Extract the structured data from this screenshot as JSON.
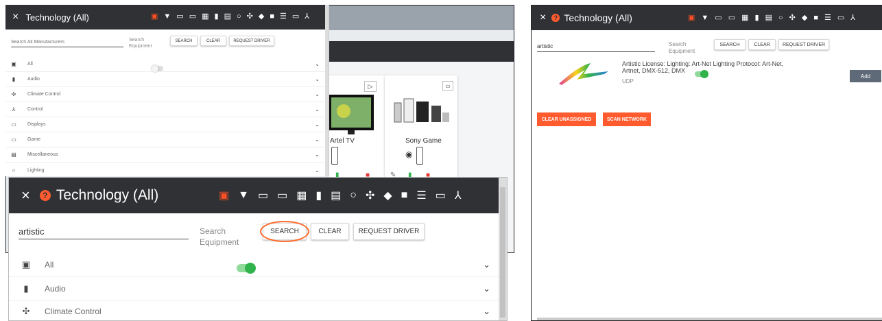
{
  "colors": {
    "header_bg": "#2f3135",
    "accent": "#ff5b2e",
    "toggle_green": "#2fb34a",
    "toggle_green_track": "#8fd99b"
  },
  "header": {
    "close_glyph": "×",
    "title": "Technology (All)",
    "help_glyph": "?"
  },
  "tech_icons": [
    "all-icon",
    "plug-icon",
    "display-icon",
    "projector-icon",
    "film-icon",
    "audio-bars-icon",
    "misc-icon",
    "lightbulb-icon",
    "fan-icon",
    "security-icon",
    "camera-icon",
    "list-icon",
    "game-icon",
    "network-icon"
  ],
  "search": {
    "placeholder": "Search All Manufacturers",
    "value": "artistic",
    "toggle_label": "Search Equipment",
    "search_button": "SEARCH",
    "clear_button": "CLEAR",
    "request_button": "REQUEST DRIVER"
  },
  "categories": [
    {
      "label": "All",
      "icon": "all-icon"
    },
    {
      "label": "Audio",
      "icon": "audio-bars-icon"
    },
    {
      "label": "Climate Control",
      "icon": "fan-icon"
    },
    {
      "label": "Control",
      "icon": "network-icon"
    },
    {
      "label": "Displays",
      "icon": "display-icon"
    },
    {
      "label": "Game",
      "icon": "game-icon"
    },
    {
      "label": "Miscellaneous",
      "icon": "misc-icon"
    },
    {
      "label": "Lighting",
      "icon": "lightbulb-icon"
    }
  ],
  "background_cards": [
    {
      "name": "Artel TV"
    },
    {
      "name": "Sony Game"
    }
  ],
  "result": {
    "title": "Artistic License: Lighting: Art-Net Lighting Protocol: Art-Net, Artnet, DMX-512, DMX",
    "protocol": "UDP",
    "add_button": "Add"
  },
  "actions": {
    "clear_unassigned": "CLEAR UNASSIGNED",
    "scan_network": "SCAN NETWORK"
  }
}
